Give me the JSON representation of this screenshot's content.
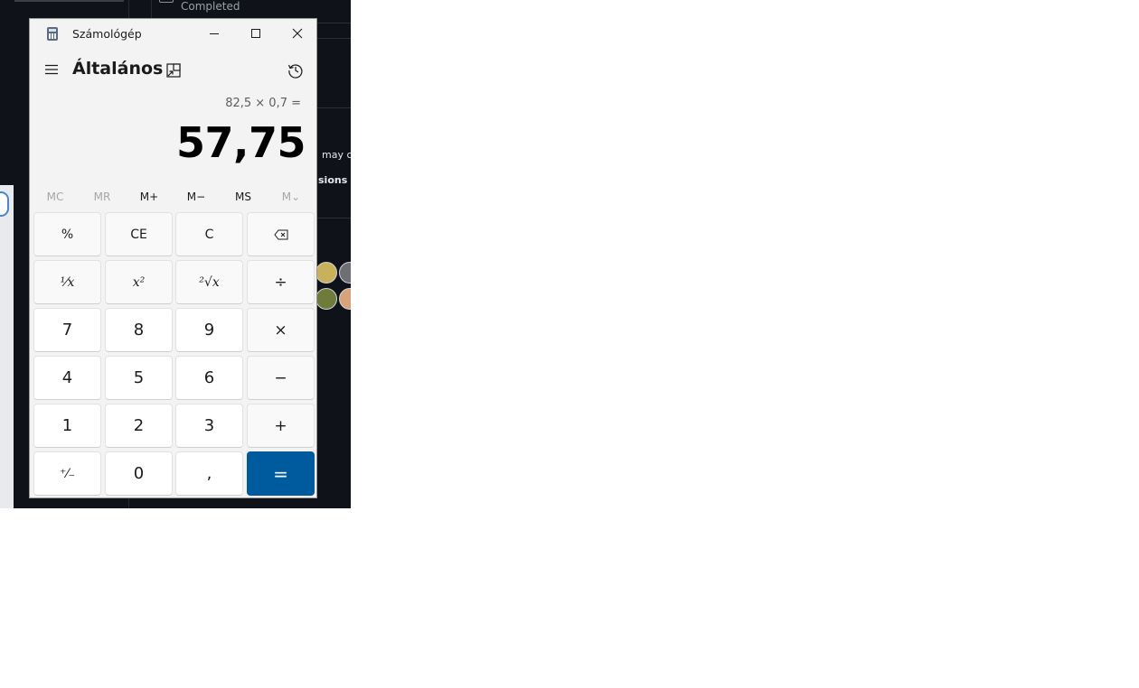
{
  "background": {
    "task_status": "Completed",
    "text_fragment_1": "may c",
    "text_fragment_2": "sions i"
  },
  "window": {
    "title": "Számológép",
    "minimize_icon": "minimize-icon",
    "maximize_icon": "maximize-icon",
    "close_icon": "close-icon"
  },
  "header": {
    "mode": "Általános",
    "menu_icon": "hamburger-icon",
    "keep_on_top_icon": "keep-on-top-icon",
    "history_icon": "history-icon"
  },
  "display": {
    "expression": "82,5 × 0,7 =",
    "result": "57,75"
  },
  "memory": [
    "MC",
    "MR",
    "M+",
    "M−",
    "MS",
    "M⌄"
  ],
  "keys": {
    "percent": "%",
    "ce": "CE",
    "c": "C",
    "backspace_icon": "backspace-icon",
    "reciprocal": "¹⁄x",
    "square": "x²",
    "sqrt": "²√x",
    "divide": "÷",
    "seven": "7",
    "eight": "8",
    "nine": "9",
    "multiply": "×",
    "four": "4",
    "five": "5",
    "six": "6",
    "minus": "−",
    "one": "1",
    "two": "2",
    "three": "3",
    "plus": "+",
    "negate": "⁺⁄₋",
    "zero": "0",
    "decimal": ",",
    "equals": "="
  },
  "colors": {
    "accent": "#005a9e",
    "window_bg": "#f3f3f3",
    "background_app": "#0f1219"
  }
}
